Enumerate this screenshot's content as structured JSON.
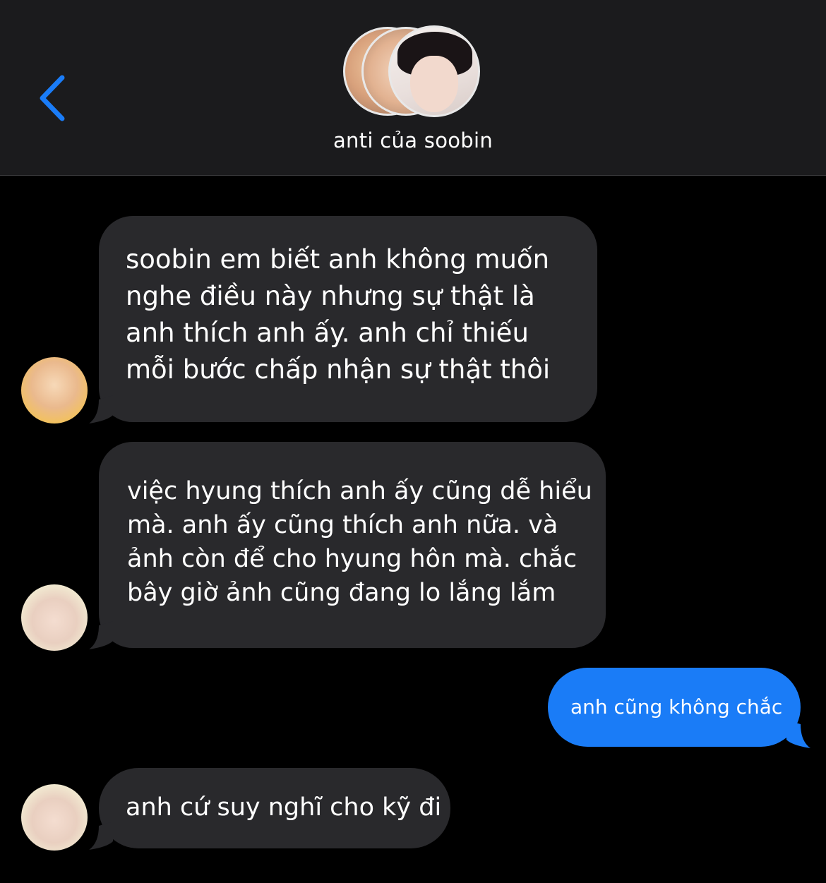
{
  "header": {
    "back_icon": "chevron-left-icon",
    "group_name": "anti của soobin",
    "accent_color": "#1a7cf7"
  },
  "messages": [
    {
      "direction": "incoming",
      "lines": [
        "soobin em biết anh không muốn",
        "nghe điều này nhưng sự thật là",
        "anh thích anh ấy. anh chỉ thiếu",
        "mỗi bước chấp nhận sự thật thôi"
      ]
    },
    {
      "direction": "incoming",
      "lines": [
        "việc hyung thích anh ấy cũng dễ hiểu",
        "mà. anh ấy cũng thích anh nữa. và",
        "ảnh còn để cho hyung hôn mà. chắc",
        "bây giờ ảnh cũng đang lo lắng lắm"
      ]
    },
    {
      "direction": "outgoing",
      "lines": [
        "anh cũng không chắc"
      ]
    },
    {
      "direction": "incoming",
      "lines": [
        "anh cứ suy nghĩ cho kỹ đi"
      ]
    }
  ],
  "colors": {
    "background": "#000000",
    "header_background": "#1b1b1d",
    "incoming_bubble": "#29292c",
    "outgoing_bubble": "#1a7cf7",
    "text": "#ffffff"
  }
}
